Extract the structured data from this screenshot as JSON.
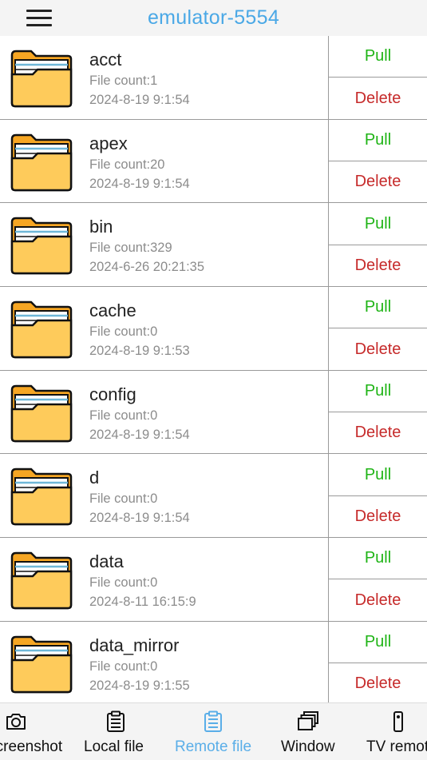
{
  "header": {
    "title": "emulator-5554",
    "menu_icon": "hamburger-menu-icon"
  },
  "actions": {
    "pull_label": "Pull",
    "delete_label": "Delete"
  },
  "colors": {
    "title": "#4aa8e6",
    "pull": "#1fb416",
    "delete": "#c62a2a",
    "active_tab": "#5aaee8",
    "folder": "#fecb5b"
  },
  "files": [
    {
      "name": "acct",
      "count": "File count:1",
      "date": "2024-8-19 9:1:54"
    },
    {
      "name": "apex",
      "count": "File count:20",
      "date": "2024-8-19 9:1:54"
    },
    {
      "name": "bin",
      "count": "File count:329",
      "date": "2024-6-26 20:21:35"
    },
    {
      "name": "cache",
      "count": "File count:0",
      "date": "2024-8-19 9:1:53"
    },
    {
      "name": "config",
      "count": "File count:0",
      "date": "2024-8-19 9:1:54"
    },
    {
      "name": "d",
      "count": "File count:0",
      "date": "2024-8-19 9:1:54"
    },
    {
      "name": "data",
      "count": "File count:0",
      "date": "2024-8-11 16:15:9"
    },
    {
      "name": "data_mirror",
      "count": "File count:0",
      "date": "2024-8-19 9:1:55"
    }
  ],
  "tabs": [
    {
      "label": "Screenshot",
      "icon": "camera-icon",
      "active": false
    },
    {
      "label": "Local file",
      "icon": "clipboard-icon",
      "active": false
    },
    {
      "label": "Remote file",
      "icon": "clipboard-icon",
      "active": true
    },
    {
      "label": "Window",
      "icon": "windows-icon",
      "active": false
    },
    {
      "label": "TV remote",
      "icon": "remote-icon",
      "active": false
    }
  ]
}
